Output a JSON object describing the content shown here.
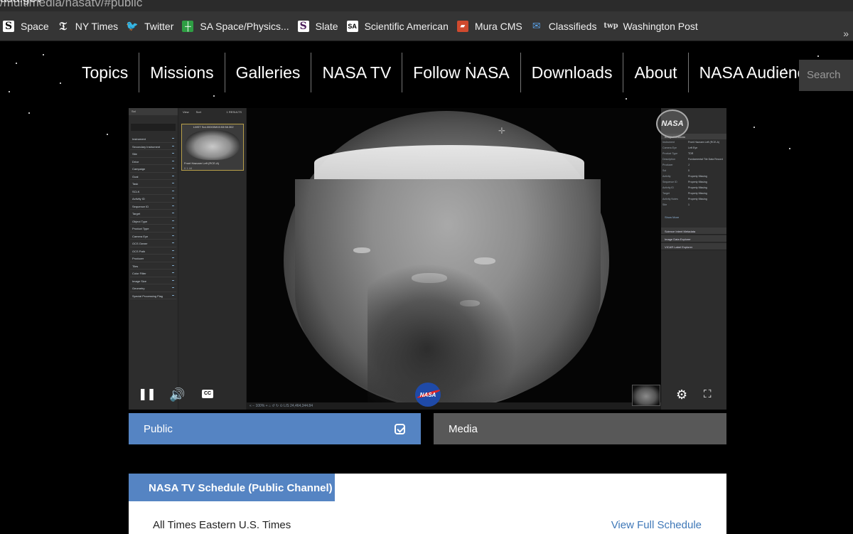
{
  "browser": {
    "url_host": "asa.gov",
    "url_path": "/multimedia/nasatv/#public",
    "bookmarks": [
      {
        "label": "Space",
        "icon": "slate-s-icon"
      },
      {
        "label": "NY Times",
        "icon": "nyt-icon"
      },
      {
        "label": "Twitter",
        "icon": "twitter-bird-icon"
      },
      {
        "label": "SA Space/Physics...",
        "icon": "sa-cross-icon"
      },
      {
        "label": "Slate",
        "icon": "slate-s-icon"
      },
      {
        "label": "Scientific American",
        "icon": "sa-logo-icon"
      },
      {
        "label": "Mura CMS",
        "icon": "mura-icon"
      },
      {
        "label": "Classifieds",
        "icon": "envelope-icon"
      },
      {
        "label": "Washington Post",
        "icon": "wp-icon"
      }
    ],
    "more": "»"
  },
  "nav": {
    "items": [
      "Topics",
      "Missions",
      "Galleries",
      "NASA TV",
      "Follow NASA",
      "Downloads",
      "About",
      "NASA Audiences"
    ],
    "search_placeholder": "Search"
  },
  "player": {
    "left_panel": {
      "header": "Sol",
      "filters": [
        "Instrument",
        "Secondary Instrument",
        "Site",
        "Drive",
        "Campaign",
        "Goal",
        "Task",
        "SCLK",
        "Activity ID",
        "Sequence ID",
        "Target",
        "Object Type",
        "Product Type",
        "Camera Eye",
        "OCS Owner",
        "OCS Path",
        "Producer",
        "Tiles",
        "Color Filter",
        "Image Size",
        "Geometry",
        "Special Processing Flag"
      ]
    },
    "middle_panel": {
      "view": "View",
      "sort": "Sort",
      "results": "1 RESULTS",
      "thumb_title": "LMST Sol-00000M15:53:58.302",
      "thumb_caption": "Front Hazcam Left (RCE-A)",
      "thumb_meta": "0   1   44"
    },
    "right_panel": {
      "header": "Image Metadata",
      "metadata": [
        [
          "Instrument",
          "Front Hazcam Left (RCE-A)"
        ],
        [
          "Camera Eye",
          "Left Eye"
        ],
        [
          "Product Type",
          "TDR"
        ],
        [
          "Description",
          "Fundamental Tile Data Record"
        ],
        [
          "Producer",
          "J"
        ],
        [
          "Sol",
          "0"
        ],
        [
          "Activity",
          "Property Missing"
        ],
        [
          "Sequence ID",
          "Property Missing"
        ],
        [
          "Activity ID",
          "Property Missing"
        ],
        [
          "Target",
          "Property Missing"
        ],
        [
          "Activity Notes",
          "Property Missing"
        ],
        [
          "Site",
          "1"
        ]
      ],
      "show_more": "Show More",
      "sections": [
        "Science Intent Metadata",
        "Image Data Explorer",
        "VICAR Label Explorer"
      ]
    },
    "status_bar": "«  −  100%  +  ⌂  ↺ ↻  ⊙   L/S 24,464,344.84",
    "watermark": "NASA",
    "logo": "NASA",
    "cc_label": "CC"
  },
  "channels": {
    "public": "Public",
    "media": "Media"
  },
  "schedule": {
    "title": "NASA TV Schedule (Public Channel)",
    "note": "All Times Eastern U.S. Times",
    "link": "View Full Schedule"
  }
}
